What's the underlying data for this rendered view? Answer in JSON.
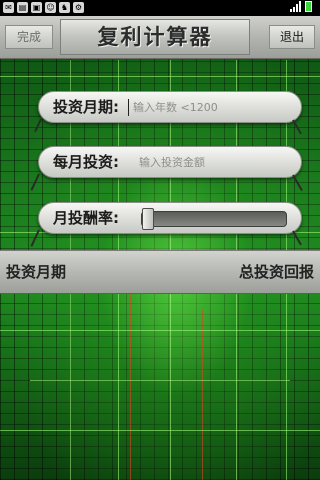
{
  "status_bar": {
    "time": "",
    "icons": [
      "notification-icon",
      "notification-icon",
      "notification-icon",
      "notification-icon",
      "notification-icon",
      "notification-icon"
    ]
  },
  "header": {
    "done_label": "完成",
    "title": "复利计算器",
    "exit_label": "退出"
  },
  "form": {
    "period": {
      "label": "投资月期:",
      "placeholder": "输入年数 <1200",
      "value": ""
    },
    "monthly": {
      "label": "每月投资:",
      "placeholder": "输入投资金额",
      "value": ""
    },
    "rate": {
      "label": "月投酬率:",
      "slider_fraction": 0.0
    }
  },
  "results": {
    "left_label": "投资月期",
    "right_label": "总投资回报"
  },
  "colors": {
    "background_green": "#1f8a20",
    "metal_light": "#e6e7e3",
    "metal_dark": "#9c9e99"
  }
}
